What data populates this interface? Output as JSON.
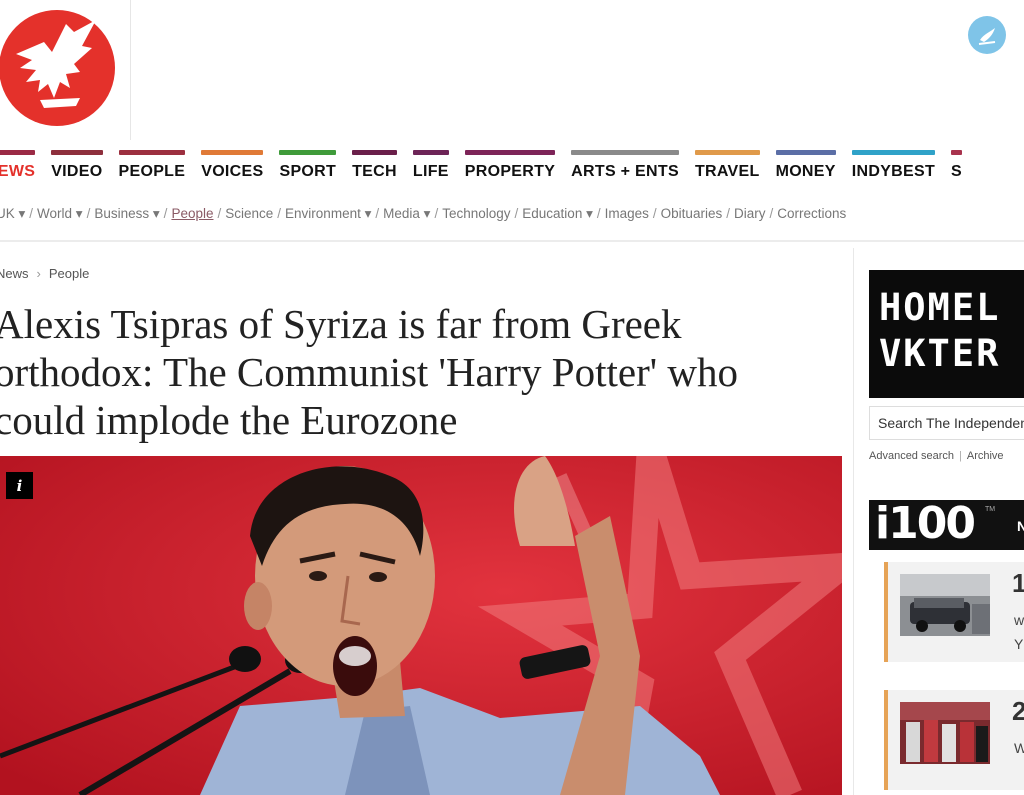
{
  "brand": {
    "logo": "eagle-logo",
    "accent": "#e4312b"
  },
  "nav": {
    "main": [
      {
        "label": "NEWS",
        "color": "#9b2a45",
        "active": true
      },
      {
        "label": "VIDEO",
        "color": "#8e2f3c"
      },
      {
        "label": "PEOPLE",
        "color": "#9c2f3f"
      },
      {
        "label": "VOICES",
        "color": "#e07a37"
      },
      {
        "label": "SPORT",
        "color": "#3f9b3a"
      },
      {
        "label": "TECH",
        "color": "#6a1f4a"
      },
      {
        "label": "LIFE",
        "color": "#6d2457"
      },
      {
        "label": "PROPERTY",
        "color": "#7d2458"
      },
      {
        "label": "ARTS + ENTS",
        "color": "#8a8a8a"
      },
      {
        "label": "TRAVEL",
        "color": "#e09a4a"
      },
      {
        "label": "MONEY",
        "color": "#5b6ea6"
      },
      {
        "label": "INDYBEST",
        "color": "#2fa2c8"
      },
      {
        "label": "S",
        "color": "#a8334d"
      }
    ],
    "sub": [
      "UK ▾",
      "World ▾",
      "Business ▾",
      "People",
      "Science",
      "Environment ▾",
      "Media ▾",
      "Technology",
      "Education ▾",
      "Images",
      "Obituaries",
      "Diary",
      "Corrections"
    ],
    "sub_current_index": 3
  },
  "breadcrumb": {
    "parent": "News",
    "current": "People"
  },
  "article": {
    "headline_lines": [
      "Alexis Tsipras of Syriza is far from Greek",
      "orthodox: The Communist 'Harry Potter' who",
      "could implode the Eurozone"
    ],
    "info_icon": "i"
  },
  "sidebar": {
    "promo_lines": [
      "HOMEL",
      "VKTER"
    ],
    "search_placeholder": "Search The Independent",
    "advanced_search": "Advanced search",
    "archive": "Archive",
    "i100_logo": "i100",
    "i100_tm": "TM",
    "i100_tab": "N",
    "items": [
      {
        "rank": "1",
        "snippet_1": "w",
        "snippet_2": "Y"
      },
      {
        "rank": "2",
        "snippet_1": "W",
        "snippet_2": ""
      }
    ]
  }
}
